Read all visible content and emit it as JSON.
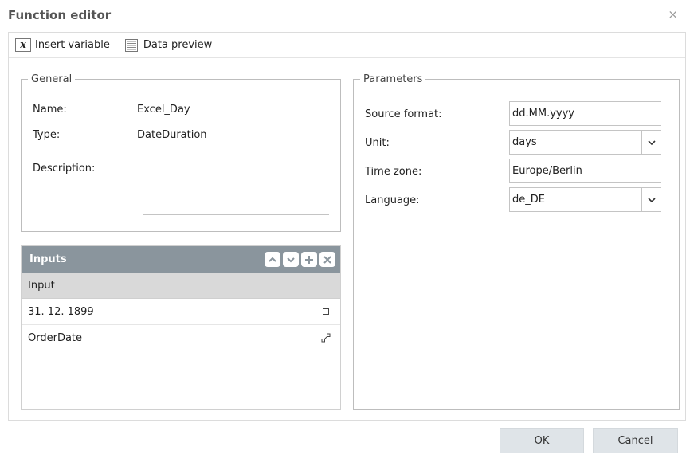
{
  "dialog": {
    "title": "Function editor",
    "close_glyph": "×"
  },
  "toolbar": {
    "insert_variable": {
      "icon_glyph": "x",
      "label": "Insert variable"
    },
    "data_preview": {
      "label": "Data preview"
    }
  },
  "general": {
    "legend": "General",
    "name_label": "Name:",
    "name_value": "Excel_Day",
    "type_label": "Type:",
    "type_value": "DateDuration",
    "description_label": "Description:",
    "description_value": ""
  },
  "inputs": {
    "title": "Inputs",
    "column_header": "Input",
    "rows": [
      {
        "value": "31. 12. 1899",
        "icon": "square-icon"
      },
      {
        "value": "OrderDate",
        "icon": "link-icon"
      }
    ]
  },
  "parameters": {
    "legend": "Parameters",
    "source_format": {
      "label": "Source format:",
      "value": "dd.MM.yyyy"
    },
    "unit": {
      "label": "Unit:",
      "value": "days"
    },
    "time_zone": {
      "label": "Time zone:",
      "value": "Europe/Berlin"
    },
    "language": {
      "label": "Language:",
      "value": "de_DE"
    }
  },
  "footer": {
    "ok_label": "OK",
    "cancel_label": "Cancel"
  },
  "colors": {
    "inputs_header": "#8a959d",
    "button_bg": "#dfe4e8",
    "title_text": "#555555"
  }
}
